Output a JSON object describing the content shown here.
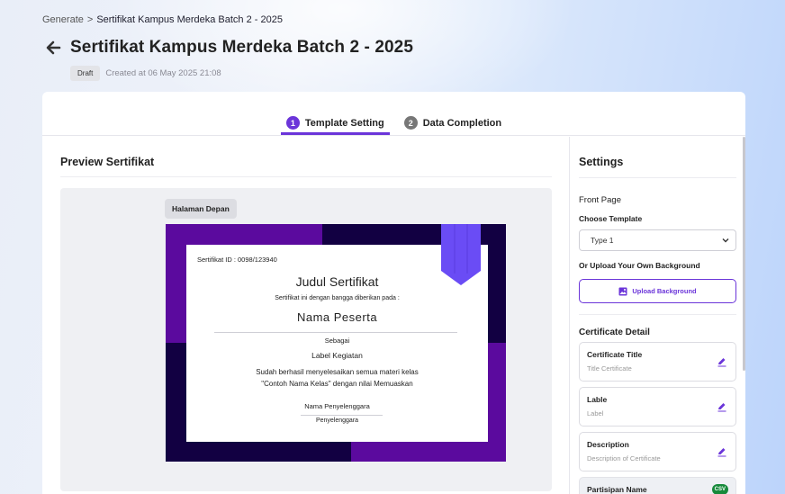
{
  "breadcrumb": {
    "root": "Generate",
    "separator": ">",
    "current": "Sertifikat Kampus Merdeka Batch 2 - 2025"
  },
  "header": {
    "title": "Sertifikat Kampus Merdeka Batch 2 - 2025",
    "status": "Draft",
    "created": "Created at 06 May 2025 21:08"
  },
  "tabs": [
    {
      "num": "1",
      "label": "Template Setting",
      "active": true
    },
    {
      "num": "2",
      "label": "Data Completion",
      "active": false
    }
  ],
  "preview": {
    "heading": "Preview Sertifikat",
    "page_chip": "Halaman Depan"
  },
  "certificate": {
    "id": "Sertifikat ID : 0098/123940",
    "title": "Judul Sertifikat",
    "subtitle": "Sertifikat ini dengan bangga diberikan pada :",
    "name": "Nama Peserta",
    "sebagai": "Sebagai",
    "label": "Label Kegiatan",
    "description": "Sudah berhasil menyelesaikan semua materi kelas \"Contoh Nama Kelas\" dengan nilai Memuaskan",
    "organizer_name": "Nama Penyelenggara",
    "organizer_role": "Penyelenggara",
    "colors": {
      "dark": "#120042",
      "purple": "#5b0a9e",
      "ribbon": "#6a4cf5"
    }
  },
  "settings": {
    "heading": "Settings",
    "front_page": "Front Page",
    "choose_template": "Choose Template",
    "template_value": "Type 1",
    "upload_own": "Or Upload Your Own Background",
    "upload_button": "Upload Background",
    "certificate_detail": "Certificate Detail",
    "fields": [
      {
        "title": "Certificate Title",
        "sub": "Title Certificate",
        "icon": "edit-icon"
      },
      {
        "title": "Lable",
        "sub": "Label",
        "icon": "edit-icon"
      },
      {
        "title": "Description",
        "sub": "Description of Certificate",
        "icon": "edit-icon"
      },
      {
        "title": "Partisipan Name",
        "badge": "CSV"
      }
    ]
  },
  "accent_color": "#6b35d9"
}
